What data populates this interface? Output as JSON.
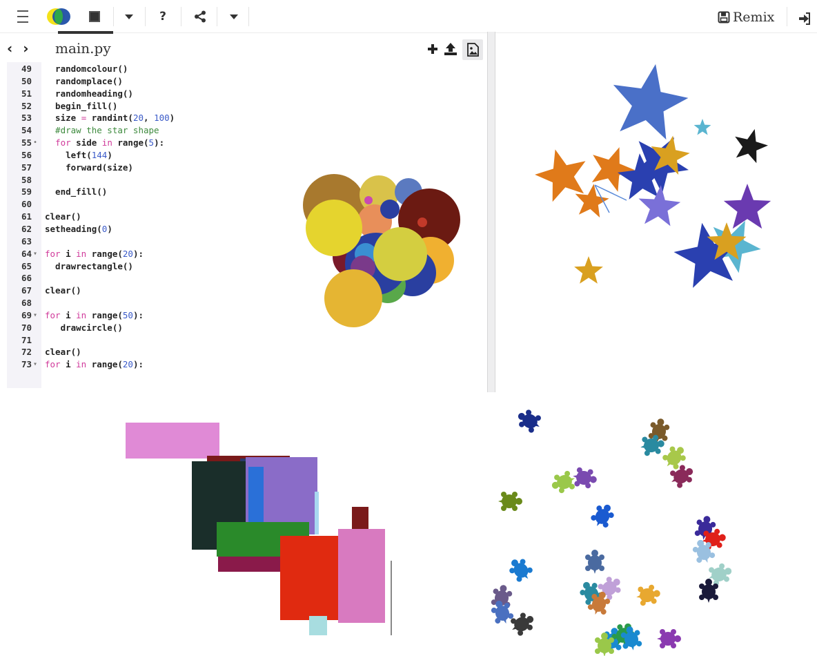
{
  "toolbar": {
    "menu_icon": "hamburger-menu-icon",
    "logo_icon": "trinket-logo-icon",
    "stop_icon": "stop-square-icon",
    "run_menu_icon": "caret-down-icon",
    "help_label": "?",
    "share_icon": "share-icon",
    "more_icon": "caret-down-icon",
    "remix_label": "Remix",
    "remix_icon": "save-icon",
    "login_icon": "sign-in-icon"
  },
  "editor": {
    "nav_label": "‹ ›",
    "file_name": "main.py",
    "add_icon": "plus-icon",
    "upload_icon": "upload-icon",
    "image_icon": "image-icon",
    "lines": [
      {
        "num": "49",
        "fold": "",
        "code": [
          {
            "t": "  randomcolour()",
            "c": ""
          }
        ]
      },
      {
        "num": "50",
        "fold": "",
        "code": [
          {
            "t": "  randomplace()",
            "c": ""
          }
        ]
      },
      {
        "num": "51",
        "fold": "",
        "code": [
          {
            "t": "  randomheading()",
            "c": ""
          }
        ]
      },
      {
        "num": "52",
        "fold": "",
        "code": [
          {
            "t": "  begin_fill()",
            "c": ""
          }
        ]
      },
      {
        "num": "53",
        "fold": "",
        "code": [
          {
            "t": "  size ",
            "c": ""
          },
          {
            "t": "=",
            "c": "kw"
          },
          {
            "t": " randint(",
            "c": ""
          },
          {
            "t": "20",
            "c": "num"
          },
          {
            "t": ", ",
            "c": ""
          },
          {
            "t": "100",
            "c": "num"
          },
          {
            "t": ")",
            "c": ""
          }
        ]
      },
      {
        "num": "54",
        "fold": "",
        "code": [
          {
            "t": "  #draw the star shape",
            "c": "cm"
          }
        ]
      },
      {
        "num": "55",
        "fold": "•",
        "code": [
          {
            "t": "  ",
            "c": ""
          },
          {
            "t": "for",
            "c": "kw"
          },
          {
            "t": " side ",
            "c": ""
          },
          {
            "t": "in",
            "c": "kw"
          },
          {
            "t": " range(",
            "c": ""
          },
          {
            "t": "5",
            "c": "num"
          },
          {
            "t": "):",
            "c": ""
          }
        ]
      },
      {
        "num": "56",
        "fold": "",
        "code": [
          {
            "t": "    left(",
            "c": ""
          },
          {
            "t": "144",
            "c": "num"
          },
          {
            "t": ")",
            "c": ""
          }
        ]
      },
      {
        "num": "57",
        "fold": "",
        "code": [
          {
            "t": "    forward(size)",
            "c": ""
          }
        ]
      },
      {
        "num": "58",
        "fold": "",
        "code": [
          {
            "t": "",
            "c": ""
          }
        ]
      },
      {
        "num": "59",
        "fold": "",
        "code": [
          {
            "t": "  end_fill()",
            "c": ""
          }
        ]
      },
      {
        "num": "60",
        "fold": "",
        "code": [
          {
            "t": "",
            "c": ""
          }
        ]
      },
      {
        "num": "61",
        "fold": "",
        "code": [
          {
            "t": "clear()",
            "c": ""
          }
        ]
      },
      {
        "num": "62",
        "fold": "",
        "code": [
          {
            "t": "setheading(",
            "c": ""
          },
          {
            "t": "0",
            "c": "num"
          },
          {
            "t": ")",
            "c": ""
          }
        ]
      },
      {
        "num": "63",
        "fold": "",
        "code": [
          {
            "t": "",
            "c": ""
          }
        ]
      },
      {
        "num": "64",
        "fold": "▾",
        "code": [
          {
            "t": "for",
            "c": "kw"
          },
          {
            "t": " i ",
            "c": ""
          },
          {
            "t": "in",
            "c": "kw"
          },
          {
            "t": " range(",
            "c": ""
          },
          {
            "t": "20",
            "c": "num"
          },
          {
            "t": "):",
            "c": ""
          }
        ]
      },
      {
        "num": "65",
        "fold": "",
        "code": [
          {
            "t": "  drawrectangle()",
            "c": ""
          }
        ]
      },
      {
        "num": "66",
        "fold": "",
        "code": [
          {
            "t": "",
            "c": ""
          }
        ]
      },
      {
        "num": "67",
        "fold": "",
        "code": [
          {
            "t": "clear()",
            "c": ""
          }
        ]
      },
      {
        "num": "68",
        "fold": "",
        "code": [
          {
            "t": "",
            "c": ""
          }
        ]
      },
      {
        "num": "69",
        "fold": "▾",
        "code": [
          {
            "t": "for",
            "c": "kw"
          },
          {
            "t": " i ",
            "c": ""
          },
          {
            "t": "in",
            "c": "kw"
          },
          {
            "t": " range(",
            "c": ""
          },
          {
            "t": "50",
            "c": "num"
          },
          {
            "t": "):",
            "c": ""
          }
        ]
      },
      {
        "num": "70",
        "fold": "",
        "code": [
          {
            "t": "   drawcircle()",
            "c": ""
          }
        ]
      },
      {
        "num": "71",
        "fold": "",
        "code": [
          {
            "t": "",
            "c": ""
          }
        ]
      },
      {
        "num": "72",
        "fold": "",
        "code": [
          {
            "t": "clear()",
            "c": ""
          }
        ]
      },
      {
        "num": "73",
        "fold": "▾",
        "code": [
          {
            "t": "for",
            "c": "kw"
          },
          {
            "t": " i ",
            "c": ""
          },
          {
            "t": "in",
            "c": "kw"
          },
          {
            "t": " range(",
            "c": ""
          },
          {
            "t": "20",
            "c": "num"
          },
          {
            "t": "):",
            "c": ""
          }
        ]
      }
    ]
  },
  "colors": {
    "keyword": "#d0399a",
    "number": "#3a5ac8",
    "comment": "#3d8a3d",
    "gutter_bg": "#f4f3f8"
  },
  "turtle_output": {
    "circles_colors": [
      "#a8792e",
      "#e5b533",
      "#5b7ac0",
      "#6b1a12",
      "#2a3fa0",
      "#d9c24a",
      "#e88f5a",
      "#3a8fd2",
      "#c23a2a",
      "#59a84a",
      "#f0b030",
      "#d4ce40",
      "#7a3a8a"
    ],
    "stars_colors": [
      "#4a70c8",
      "#e07a1a",
      "#d9a020",
      "#1a1a1a",
      "#2a40b0",
      "#6a3ab0",
      "#5ab5d0",
      "#7a70d8"
    ],
    "rect_colors": [
      "#e08ad6",
      "#1a2e2a",
      "#8a6cc8",
      "#2a70d8",
      "#2a8a2a",
      "#8a1a4a",
      "#e02a10",
      "#d87ac0",
      "#7a1a1a",
      "#a8dde0"
    ],
    "turtle_colors": [
      "#1a2e8a",
      "#7a5a2a",
      "#2a8aa0",
      "#a8c84a",
      "#8a2a5a",
      "#9ac84a",
      "#7a4ab0",
      "#6a8a1a",
      "#1a5ad0",
      "#3a2a9a",
      "#e0201a",
      "#9ac0e0",
      "#a0d0c8",
      "#1a1a3a",
      "#1a7ad0",
      "#4a6aa0",
      "#c0a0d8",
      "#c87a3a",
      "#e8a830",
      "#6a5a8a",
      "#4a70c0",
      "#3a3a3a",
      "#1a8ad0",
      "#2a9a4a",
      "#8a3ab0"
    ]
  }
}
